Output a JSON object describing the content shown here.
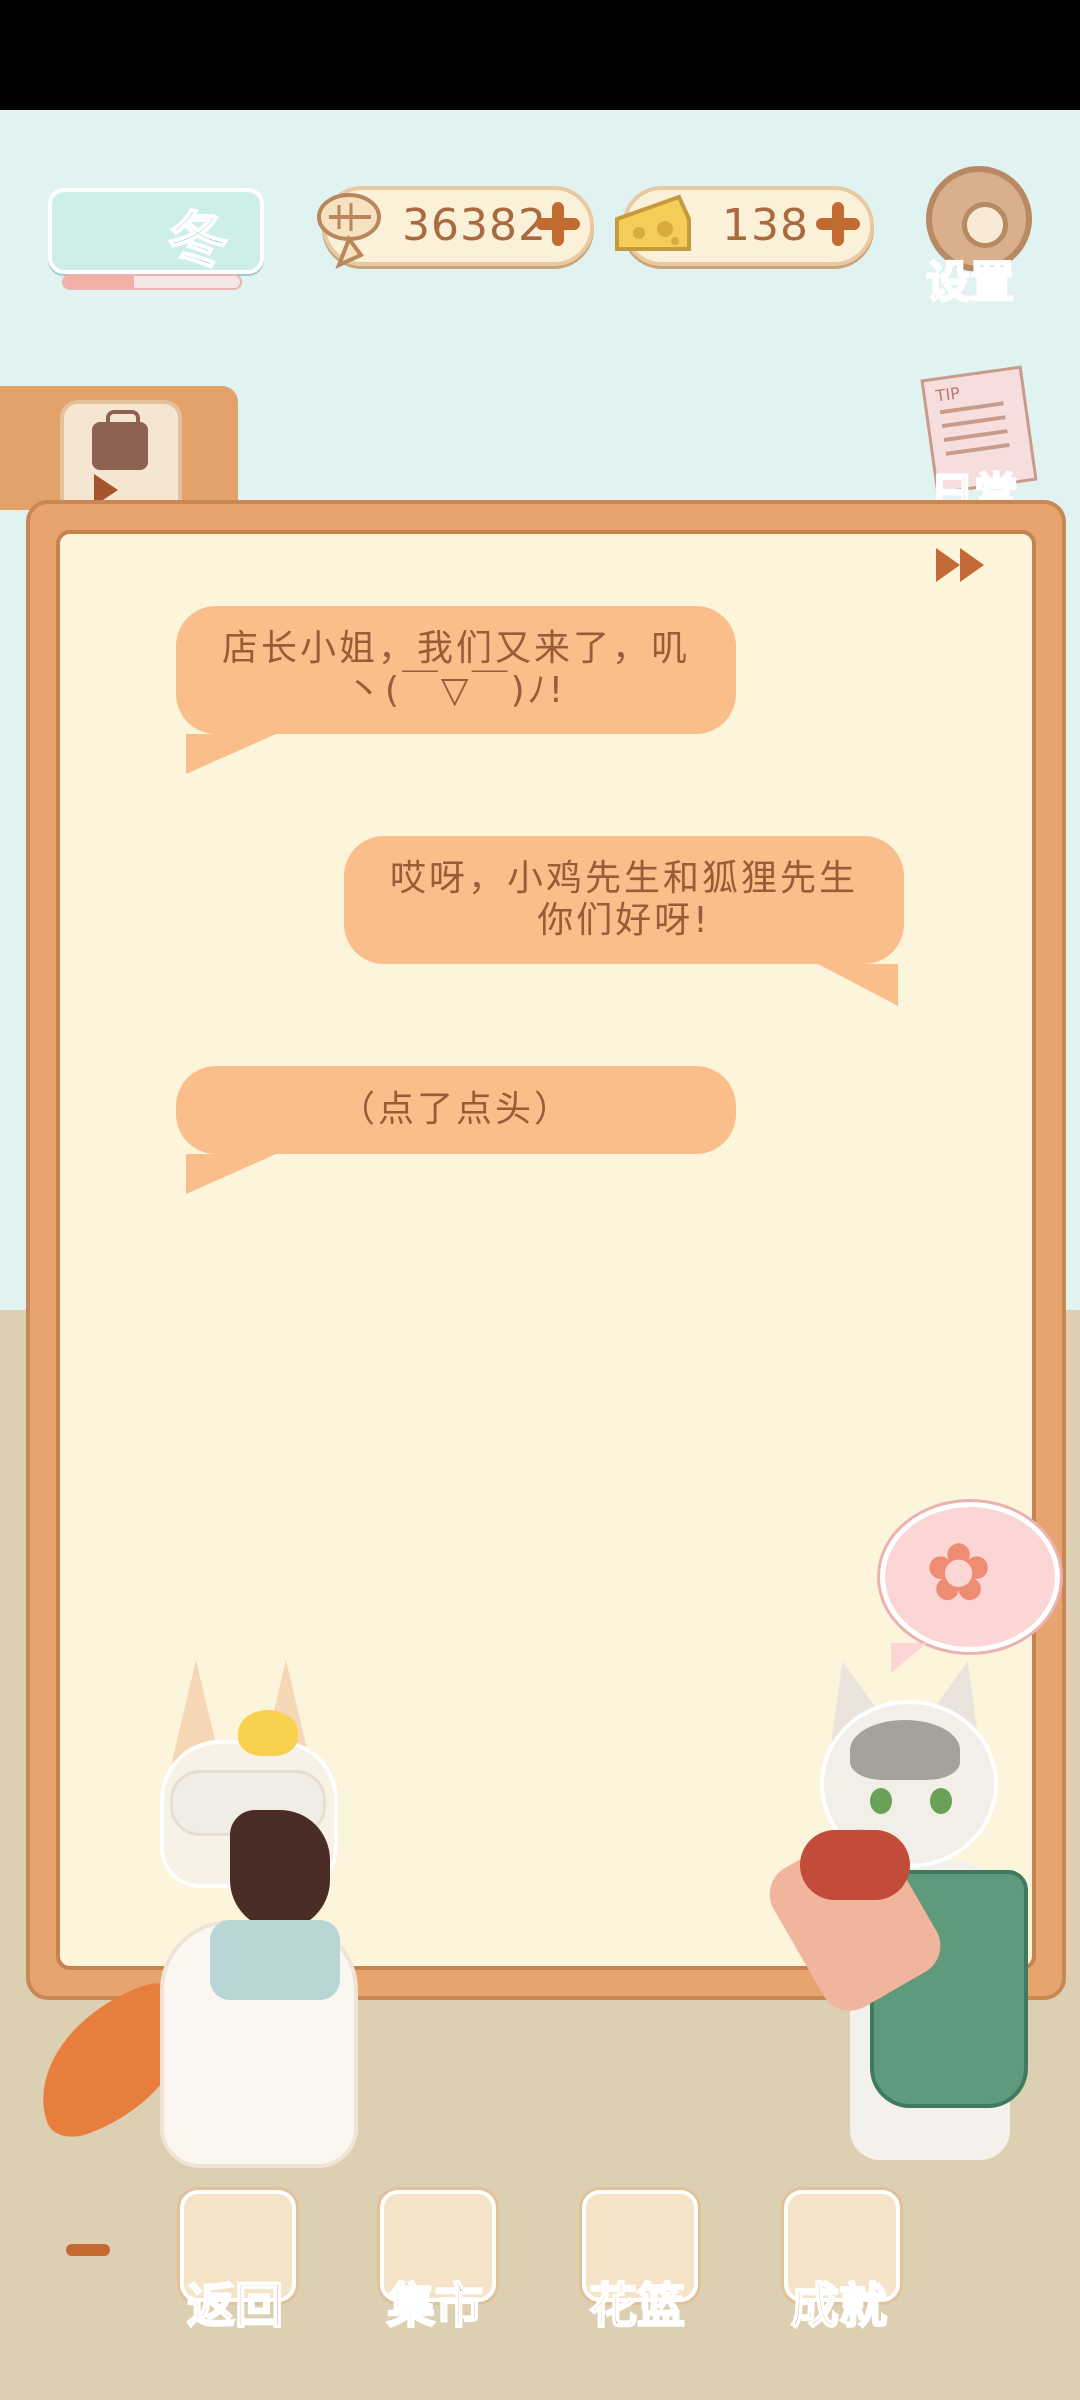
{
  "hud": {
    "season": "冬",
    "season_progress": 0.4,
    "fish_amount": "36382",
    "cheese_amount": "138",
    "settings_label": "设置",
    "daily_label": "日常",
    "memo_tag": "TIP"
  },
  "dialogue": [
    {
      "speaker_side": "left",
      "text": "店长小姐，我们又来了，叽丶(￣▽￣)ﾉ!"
    },
    {
      "speaker_side": "right",
      "text": "哎呀，小鸡先生和狐狸先生你们好呀!"
    },
    {
      "speaker_side": "left",
      "text": "（点了点头）"
    }
  ],
  "bottom_nav": [
    {
      "label": "返回",
      "icon": "back-icon"
    },
    {
      "label": "集市",
      "icon": "market-stall-icon"
    },
    {
      "label": "花篮",
      "icon": "flower-basket-icon"
    },
    {
      "label": "成就",
      "icon": "trophy-icon"
    }
  ],
  "colors": {
    "accent": "#c46a36",
    "bubble": "#f9be8a",
    "panel_bg": "#fdf4dc",
    "sky": "#e0f3f1",
    "floor": "#dccfb2"
  }
}
